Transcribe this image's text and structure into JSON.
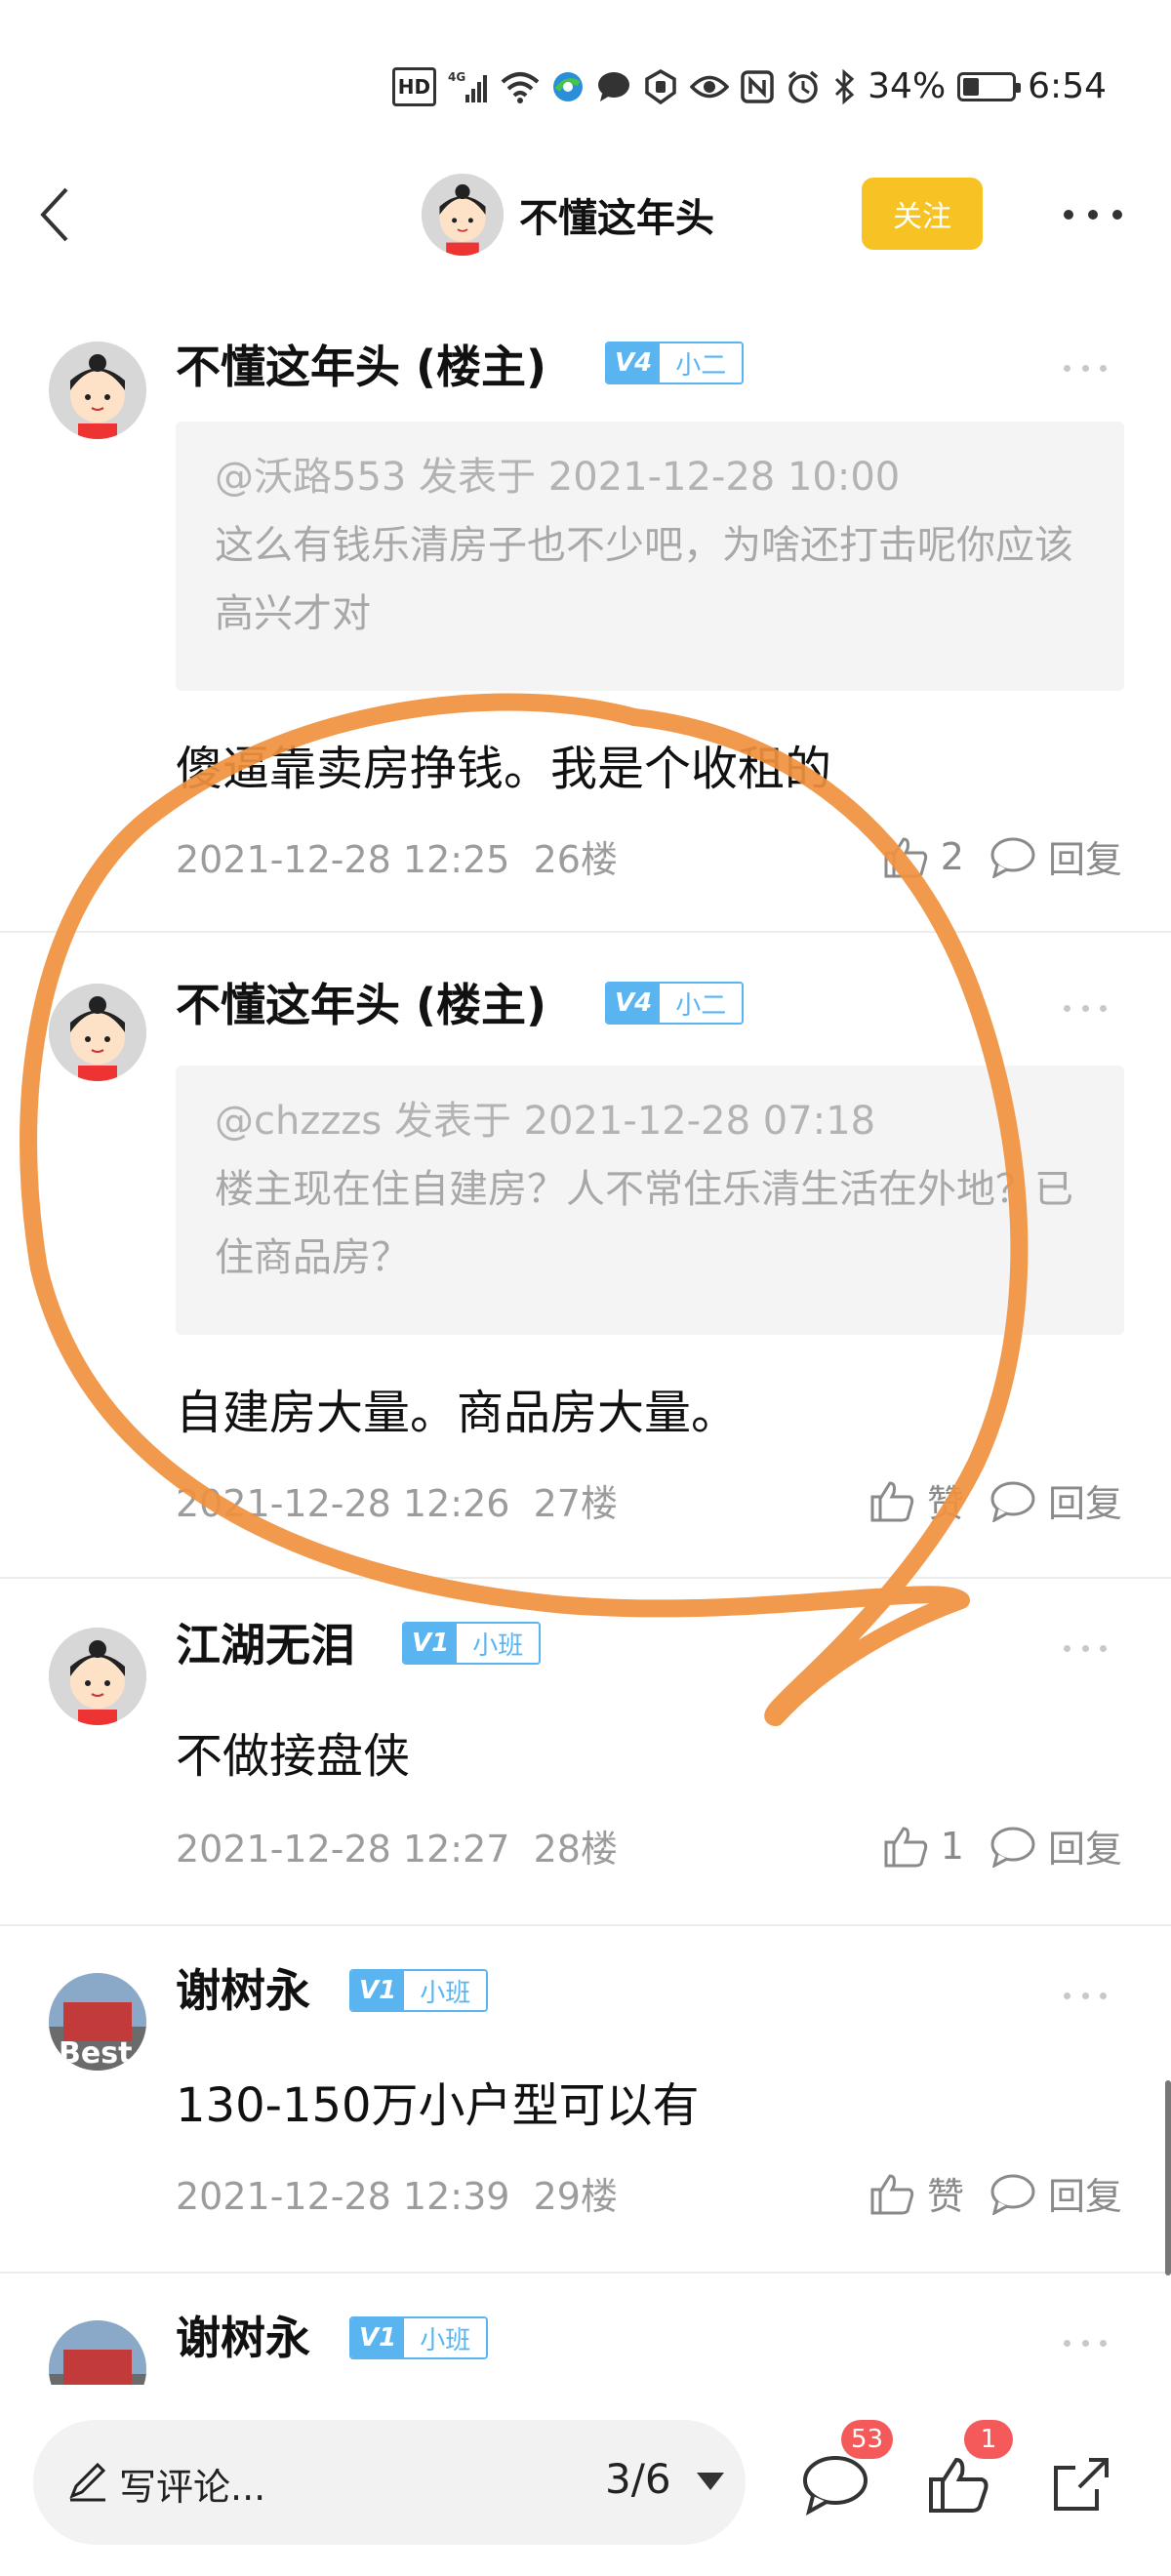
{
  "status_bar": {
    "hd": "HD",
    "network": "4G",
    "battery_percent": "34%",
    "battery_level": 0.34,
    "time": "6:54",
    "icons": [
      "signal-icon",
      "wifi-icon",
      "browser-icon",
      "message-icon",
      "shield-icon",
      "eye-icon",
      "nfc-icon",
      "alarm-icon",
      "bluetooth-icon",
      "battery-icon"
    ]
  },
  "header": {
    "title": "不懂这年头",
    "follow_label": "关注"
  },
  "posts": [
    {
      "username": "不懂这年头 (楼主)",
      "level": "V4",
      "rank": "小二",
      "quote_head": "@沃路553 发表于 2021-12-28 10:00",
      "quote_body": "这么有钱乐清房子也不少吧，为啥还打击呢你应该高兴才对",
      "content": "傻逼靠卖房挣钱。我是个收租的",
      "timestamp": "2021-12-28 12:25",
      "floor": "26楼",
      "likes": "2",
      "reply_label": "回复"
    },
    {
      "username": "不懂这年头 (楼主)",
      "level": "V4",
      "rank": "小二",
      "quote_head": "@chzzzs 发表于 2021-12-28 07:18",
      "quote_body": "楼主现在住自建房？人不常住乐清生活在外地？已住商品房？",
      "content": "自建房大量。商品房大量。",
      "timestamp": "2021-12-28 12:26",
      "floor": "27楼",
      "likes": "赞",
      "reply_label": "回复"
    },
    {
      "username": "江湖无泪",
      "level": "V1",
      "rank": "小班",
      "content": "不做接盘侠",
      "timestamp": "2021-12-28 12:27",
      "floor": "28楼",
      "likes": "1",
      "reply_label": "回复"
    },
    {
      "username": "谢树永",
      "level": "V1",
      "rank": "小班",
      "content": "130-150万小户型可以有",
      "timestamp": "2021-12-28 12:39",
      "floor": "29楼",
      "likes": "赞",
      "reply_label": "回复"
    },
    {
      "username": "谢树永",
      "level": "V1",
      "rank": "小班"
    }
  ],
  "bottom_bar": {
    "comment_placeholder": "写评论...",
    "page_indicator": "3/6",
    "comments_count": "53",
    "likes_count": "1"
  },
  "colors": {
    "follow_button": "#f7c223",
    "level_badge": "#5ab4f0",
    "notification_badge": "#f55a5a",
    "annotation_stroke": "#f0913f"
  }
}
